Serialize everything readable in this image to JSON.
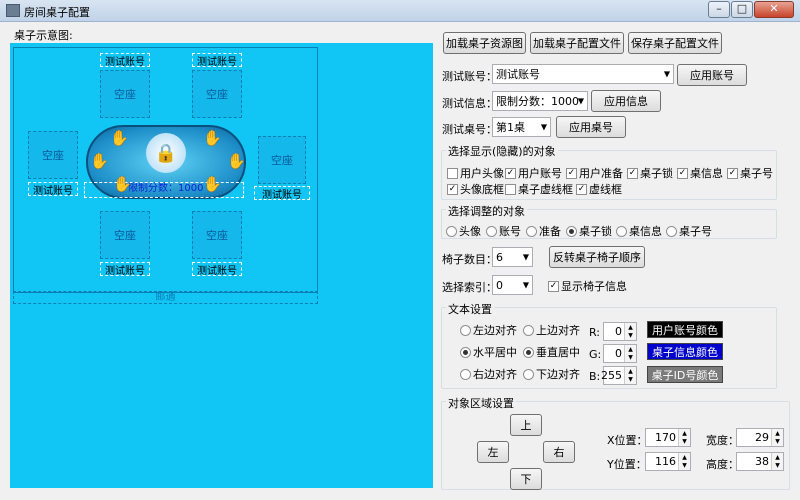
{
  "window": {
    "title": "房间桌子配置"
  },
  "preview": {
    "heading": "桌子示意图:",
    "seat_empty": "空座",
    "seat_account": "测试账号",
    "limit_text": "限制分数：1000",
    "bottom_label": "邮通"
  },
  "toolbar": {
    "load_res": "加载桌子资源图",
    "load_config": "加载桌子配置文件",
    "save_config": "保存桌子配置文件"
  },
  "account": {
    "label": "测试账号：",
    "value": "测试账号",
    "apply": "应用账号"
  },
  "info": {
    "label": "测试信息：",
    "value": "限制分数：1000",
    "apply": "应用信息"
  },
  "table_no": {
    "label": "测试桌号：",
    "value": "第1桌",
    "apply": "应用桌号"
  },
  "show_group": {
    "title": "选择显示(隐藏)的对象",
    "items": [
      {
        "label": "用户头像",
        "checked": false
      },
      {
        "label": "用户账号",
        "checked": true
      },
      {
        "label": "用户准备",
        "checked": true
      },
      {
        "label": "桌子锁",
        "checked": true
      },
      {
        "label": "桌信息",
        "checked": true
      },
      {
        "label": "桌子号",
        "checked": true
      },
      {
        "label": "头像底框",
        "checked": true
      },
      {
        "label": "桌子虚线框",
        "checked": false
      },
      {
        "label": "虚线框",
        "checked": true
      }
    ]
  },
  "adjust_group": {
    "title": "选择调整的对象",
    "items": [
      {
        "label": "头像",
        "selected": false
      },
      {
        "label": "账号",
        "selected": false
      },
      {
        "label": "准备",
        "selected": false
      },
      {
        "label": "桌子锁",
        "selected": true
      },
      {
        "label": "桌信息",
        "selected": false
      },
      {
        "label": "桌子号",
        "selected": false
      }
    ]
  },
  "chairs": {
    "label": "椅子数目：",
    "value": "6",
    "reverse": "反转桌子椅子顺序"
  },
  "index": {
    "label": "选择索引：",
    "value": "0",
    "show_info": "显示椅子信息",
    "show_info_checked": true
  },
  "text_group": {
    "title": "文本设置",
    "h_left": "左边对齐",
    "h_center": "水平居中",
    "h_right": "右边对齐",
    "v_top": "上边对齐",
    "v_center": "垂直居中",
    "v_bottom": "下边对齐",
    "r_label": "R:",
    "r_value": "0",
    "g_label": "G:",
    "g_value": "0",
    "b_label": "B:",
    "b_value": "255",
    "color_account": "用户账号颜色",
    "color_info": "桌子信息颜色",
    "color_id": "桌子ID号颜色",
    "colors": {
      "account": "#000000",
      "info": "#0000cc",
      "id": "#7a7a7a"
    }
  },
  "region_group": {
    "title": "对象区域设置",
    "up": "上",
    "down": "下",
    "left": "左",
    "right": "右",
    "x_label": "X位置：",
    "x_value": "170",
    "y_label": "Y位置：",
    "y_value": "116",
    "w_label": "宽度：",
    "w_value": "29",
    "h_label": "高度：",
    "h_value": "38"
  }
}
